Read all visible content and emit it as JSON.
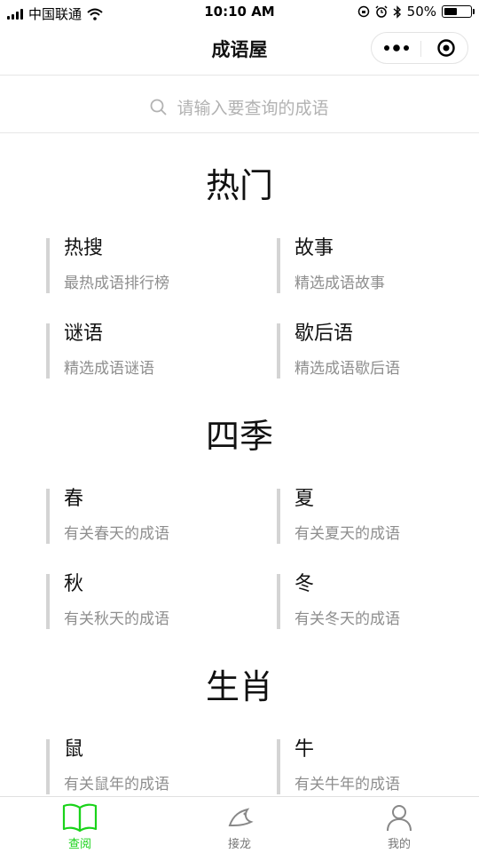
{
  "status_bar": {
    "carrier": "中国联通",
    "time": "10:10 AM",
    "battery": "50%",
    "battery_level": 0.5
  },
  "nav": {
    "title": "成语屋"
  },
  "search": {
    "placeholder": "请输入要查询的成语"
  },
  "sections": [
    {
      "title": "热门",
      "items": [
        {
          "title": "热搜",
          "subtitle": "最热成语排行榜"
        },
        {
          "title": "故事",
          "subtitle": "精选成语故事"
        },
        {
          "title": "谜语",
          "subtitle": "精选成语谜语"
        },
        {
          "title": "歇后语",
          "subtitle": "精选成语歇后语"
        }
      ]
    },
    {
      "title": "四季",
      "items": [
        {
          "title": "春",
          "subtitle": "有关春天的成语"
        },
        {
          "title": "夏",
          "subtitle": "有关夏天的成语"
        },
        {
          "title": "秋",
          "subtitle": "有关秋天的成语"
        },
        {
          "title": "冬",
          "subtitle": "有关冬天的成语"
        }
      ]
    },
    {
      "title": "生肖",
      "items": [
        {
          "title": "鼠",
          "subtitle": "有关鼠年的成语"
        },
        {
          "title": "牛",
          "subtitle": "有关牛年的成语"
        }
      ]
    }
  ],
  "tabbar": {
    "items": [
      {
        "label": "查阅",
        "icon": "book-icon",
        "active": true
      },
      {
        "label": "接龙",
        "icon": "dragon-icon",
        "active": false
      },
      {
        "label": "我的",
        "icon": "user-icon",
        "active": false
      }
    ]
  },
  "colors": {
    "accent": "#1ad31a",
    "text": "#111111",
    "subtext": "#8e8e8e",
    "border": "#d4d4d4"
  }
}
